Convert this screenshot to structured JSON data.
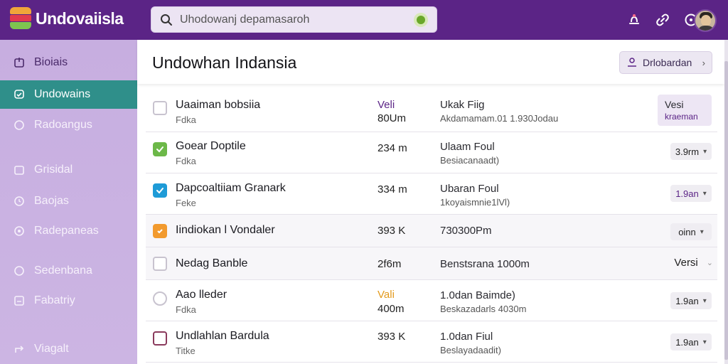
{
  "app": {
    "name": "Undovaiisla"
  },
  "search": {
    "placeholder": "Uhodowanj depamasaroh"
  },
  "sidebar": {
    "items": [
      {
        "label": "Bioiais",
        "icon": "inbox-icon"
      },
      {
        "label": "Undowains",
        "icon": "chat-icon"
      },
      {
        "label": "Radoangus",
        "icon": "tag-icon"
      },
      {
        "label": "Grisidal",
        "icon": "folder-icon"
      },
      {
        "label": "Baojas",
        "icon": "clock-icon"
      },
      {
        "label": "Radepaneas",
        "icon": "settings-icon"
      },
      {
        "label": "Sedenbana",
        "icon": "person-icon"
      },
      {
        "label": "Fabatriy",
        "icon": "document-icon"
      },
      {
        "label": "Viagalt",
        "icon": "share-icon"
      }
    ]
  },
  "header": {
    "title": "Undowhan Indansia",
    "button_label": "Drlobardan"
  },
  "rows": [
    {
      "name": "Uaaiman bobsiia",
      "sub": "Fdka",
      "value": "Veli",
      "value2": "80Um",
      "info": "Ukak Fiig",
      "info2": "Akdamamam.01 1.930Jodau",
      "control": "badge",
      "control_line1": "Vesi",
      "control_line2": "kraeman",
      "checkbox": "empty"
    },
    {
      "name": "Goear Doptile",
      "sub": "Fdka",
      "value": "234 m",
      "info": "Ulaam Foul",
      "info2": "Besiacanaadt)",
      "control": "pill",
      "control_label": "3.9rm",
      "checkbox": "green"
    },
    {
      "name": "Dapcoaltiiam Granark",
      "sub": "Feke",
      "value": "334 m",
      "info": "Ubaran Foul",
      "info2": "1koyaismnie1lVl)",
      "control": "pill",
      "control_label": "1.9an",
      "checkbox": "blue"
    },
    {
      "name": "Iindiokan l Vondaler",
      "sub": "",
      "value": "393 K",
      "info": "730300Pm",
      "info2": "",
      "control": "pill",
      "control_label": "oinn",
      "checkbox": "orange"
    },
    {
      "name": "Nedag Banble",
      "sub": "",
      "value": "2f6m",
      "info": "Benstsrana 1000m",
      "info2": "",
      "control": "plain",
      "control_label": "Versi",
      "checkbox": "empty"
    },
    {
      "name": "Aao lleder",
      "sub": "Fdka",
      "value": "Vali",
      "value2": "400m",
      "info": "1.0dan Baimde)",
      "info2": "Beskazadarls 4030m",
      "control": "pill",
      "control_label": "1.9an",
      "checkbox": "round"
    },
    {
      "name": "Undlahlan Bardula",
      "sub": "Titke",
      "value": "393 K",
      "info": "1.0dan Fiul",
      "info2": "Beslayadaadit)",
      "control": "pill",
      "control_label": "1.9an",
      "checkbox": "plum"
    }
  ],
  "colors": {
    "topbar": "#5b2486",
    "sidebar": "#c7aee0",
    "active_item": "#2f8f8a",
    "accent_orange": "#e39a1c"
  }
}
